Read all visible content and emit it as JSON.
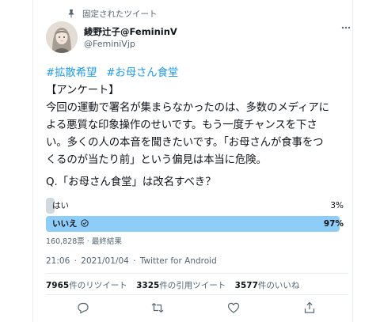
{
  "pinned": {
    "label": "固定されたツイート",
    "icon": "pin-icon"
  },
  "author": {
    "display_name": "綾野辻子@FemininV",
    "handle": "@FeminiVjp",
    "avatar": "avatar"
  },
  "tweet": {
    "hashtags": [
      "#拡散希望",
      "#お母さん食堂"
    ],
    "lines": [
      "【アンケート】",
      "今回の運動で署名が集まらなかったのは、多数のメディアに",
      "よる悪質な印象操作のせいです。もう一度チャンスを下さ",
      "い。多くの人の本音を聞きたいです。「お母さんが食事をつ",
      "くるのが当たり前」という偏見は本当に危険。"
    ],
    "question": "Q.「お母さん食堂」は改名すべき？"
  },
  "poll": {
    "options": [
      {
        "label": "はい",
        "percent_text": "3%",
        "percent": 3,
        "winner": false
      },
      {
        "label": "いいえ",
        "percent_text": "97%",
        "percent": 97,
        "winner": true
      }
    ],
    "summary": "160,828票 · 最終結果"
  },
  "meta": {
    "time": "21:06",
    "date": "2021/01/04",
    "source": "Twitter for Android"
  },
  "stats": {
    "retweets_count": "7965",
    "retweets_label": "件のリツイート",
    "quotes_count": "3325",
    "quotes_label": "件の引用ツイート",
    "likes_count": "3577",
    "likes_label": "件のいいね"
  },
  "colors": {
    "accent": "#1d9bf0",
    "winner_bar": "#8ecdf8",
    "loser_bar": "#cfd9de",
    "secondary_text": "#536471"
  }
}
